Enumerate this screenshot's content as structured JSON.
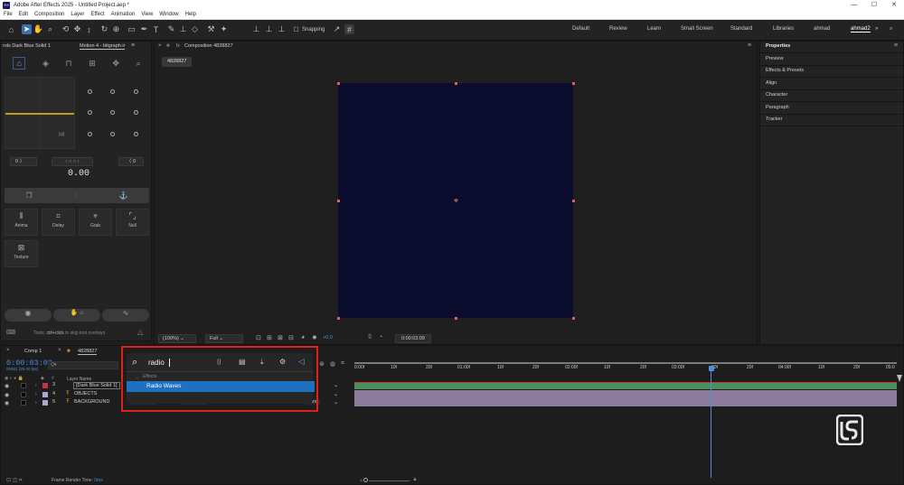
{
  "app": {
    "title": "Adobe After Effects 2025 - Untitled Project.aep *",
    "icon_text": "Ae"
  },
  "window_controls": {
    "minimize": "—",
    "maximize": "☐",
    "close": "✕"
  },
  "menu": [
    "File",
    "Edit",
    "Composition",
    "Layer",
    "Effect",
    "Animation",
    "View",
    "Window",
    "Help"
  ],
  "toolbar": {
    "snapping_label": "Snapping",
    "workspaces": [
      "Default",
      "Review",
      "Learn",
      "Small Screen",
      "Standard",
      "Libraries",
      "ahmad",
      "ahmad2"
    ],
    "active_workspace": "ahmad2"
  },
  "left_panel": {
    "tab1": "rols Dark Blue Solid 1",
    "tab2": "Motion 4 - bitgraph.ir",
    "value_left": "0",
    "value_right": "0",
    "center_value": "0.00",
    "buttons": [
      {
        "label": "Anima",
        "icon": "anchor-icon"
      },
      {
        "label": "Delay",
        "icon": "crop-icon"
      },
      {
        "label": "Grab",
        "icon": "grab-icon"
      },
      {
        "label": "Null",
        "icon": "null-icon"
      }
    ],
    "texture_label": "Texture",
    "tip_prefix": "Tools:",
    "tip_key": "ctrl+click",
    "tip_suffix": "to skip tool overlays"
  },
  "composition": {
    "tab_label": "Composition 4828827",
    "sub_tab": "4828827",
    "zoom": "(100%)",
    "quality": "Full",
    "offset": "+0.0",
    "time": "0:00:03:09",
    "bg_color": "#0b0c2e"
  },
  "right_panel": {
    "title": "Properties",
    "items": [
      "Preview",
      "Effects & Presets",
      "Align",
      "Character",
      "Paragraph",
      "Tracker"
    ]
  },
  "timeline": {
    "tabs": [
      "Comp 1",
      "4828827"
    ],
    "current_time": "0:00:03:09",
    "fps_info": "00081 (25.00 fps)",
    "search_placeholder": "Q▾",
    "column_layer_name": "Layer Name",
    "ruler": [
      "0:00f",
      "10f",
      "20f",
      "01:00f",
      "10f",
      "20f",
      "02:00f",
      "10f",
      "20f",
      "03:00f",
      "10f",
      "20f",
      "04:00f",
      "10f",
      "20f",
      "05:0"
    ],
    "layers": [
      {
        "num": "3",
        "name": "[Dark Blue Solid 1]",
        "color": "#c8363d",
        "track": "#4a8f59"
      },
      {
        "num": "4",
        "name": "OBJECTS",
        "color": "#a9a9d8",
        "track": "#8b7a9a"
      },
      {
        "num": "5",
        "name": "BACKGROUND",
        "color": "#a9a9d8",
        "track": "#8b7a9a"
      }
    ],
    "mode_normal": "Normal",
    "mode_nomat": "No Mat",
    "mode_none": "None",
    "footer": "Frame Render Time:",
    "footer_value": "0ms"
  },
  "search_overlay": {
    "query": "radio",
    "category": "Effects",
    "result": "Radio Waves"
  },
  "colors": {
    "accent_blue": "#3d7dcc",
    "red_box": "#e0201a",
    "playhead": "#4a8fe0"
  }
}
